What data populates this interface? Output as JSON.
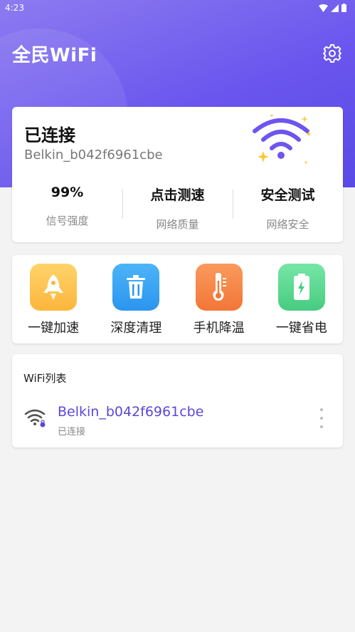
{
  "status_bar": {
    "time": "4:23"
  },
  "header": {
    "title": "全民WiFi"
  },
  "status_card": {
    "connection_state": "已连接",
    "ssid": "Belkin_b042f6961cbe",
    "stats": [
      {
        "value": "99%",
        "label": "信号强度"
      },
      {
        "value": "点击测速",
        "label": "网络质量"
      },
      {
        "value": "安全测试",
        "label": "网络安全"
      }
    ]
  },
  "tools": [
    {
      "label": "一键加速",
      "icon": "rocket-icon",
      "color": "#fcc44e"
    },
    {
      "label": "深度清理",
      "icon": "trash-icon",
      "color": "#3aa6f5"
    },
    {
      "label": "手机降温",
      "icon": "thermometer-icon",
      "color": "#f7884a"
    },
    {
      "label": "一键省电",
      "icon": "battery-icon",
      "color": "#5fdc94"
    }
  ],
  "wifi_list": {
    "title": "WiFi列表",
    "items": [
      {
        "name": "Belkin_b042f6961cbe",
        "status": "已连接"
      }
    ]
  },
  "colors": {
    "accent": "#6a56ee",
    "link": "#5b47d9"
  }
}
